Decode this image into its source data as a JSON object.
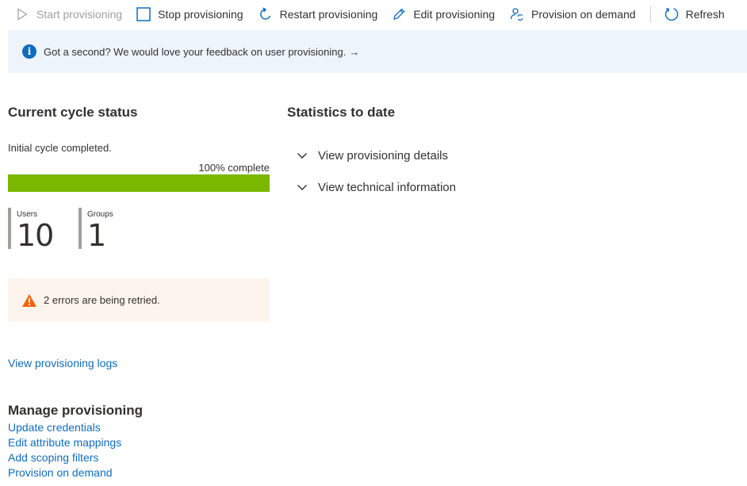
{
  "toolbar": {
    "start": "Start provisioning",
    "stop": "Stop provisioning",
    "restart": "Restart provisioning",
    "edit": "Edit provisioning",
    "on_demand": "Provision on demand",
    "refresh": "Refresh"
  },
  "banner": {
    "text": "Got a second? We would love your feedback on user provisioning.",
    "arrow": "→"
  },
  "cycle": {
    "title": "Current cycle status",
    "status_text": "Initial cycle completed.",
    "percent_label": "100% complete",
    "progress": 1.0,
    "stats": [
      {
        "label": "Users",
        "value": "10"
      },
      {
        "label": "Groups",
        "value": "1"
      }
    ],
    "warning": "2 errors are being retried."
  },
  "stats_to_date": {
    "title": "Statistics to date",
    "items": [
      "View provisioning details",
      "View technical information"
    ]
  },
  "logs_link": "View provisioning logs",
  "manage": {
    "title": "Manage provisioning",
    "links": [
      "Update credentials",
      "Edit attribute mappings",
      "Add scoping filters",
      "Provision on demand"
    ]
  },
  "colors": {
    "accent": "#0f6cbd",
    "progress": "#7ab800",
    "warning": "#f7630c",
    "banner_bg": "#eef4fc",
    "warning_bg": "#fdf4ee"
  }
}
